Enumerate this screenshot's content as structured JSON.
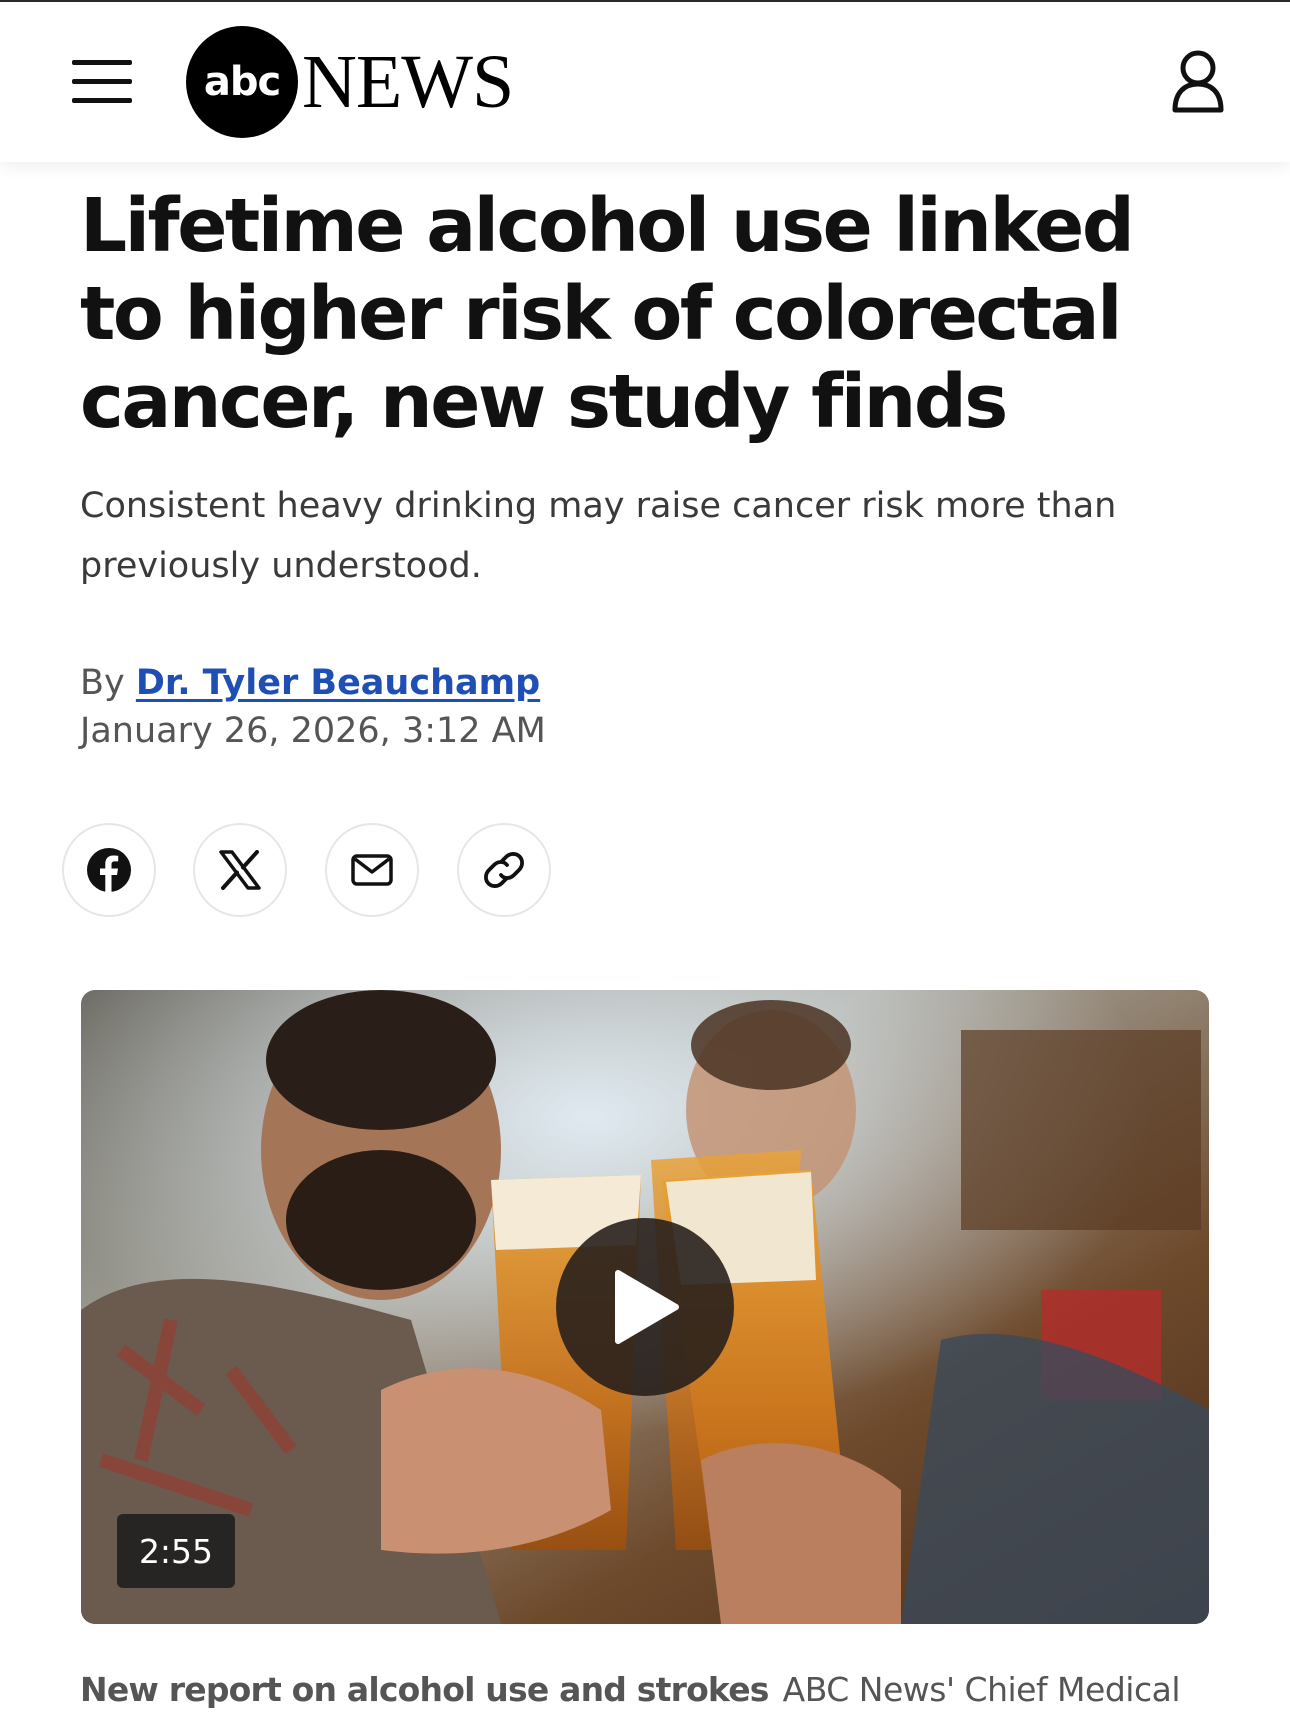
{
  "header": {
    "menu_icon": "hamburger-menu-icon",
    "logo_mark": "abc",
    "logo_word": "NEWS",
    "account_icon": "user-account-icon"
  },
  "article": {
    "headline": "Lifetime alcohol use linked to higher risk of colorectal cancer, new study finds",
    "subheadline": "Consistent heavy drinking may raise cancer risk more than previously understood.",
    "byline_prefix": "By",
    "author": "Dr. Tyler Beauchamp",
    "timestamp": "January 26, 2026, 3:12 AM"
  },
  "share": [
    {
      "icon": "facebook-icon"
    },
    {
      "icon": "x-icon"
    },
    {
      "icon": "email-icon"
    },
    {
      "icon": "link-icon"
    }
  ],
  "video": {
    "duration": "2:55",
    "play_icon": "play-icon",
    "caption_title": "New report on alcohol use and strokes",
    "caption_text": "ABC News' Chief Medical"
  },
  "colors": {
    "author_link": "#1f4fb5",
    "headline": "#111111",
    "secondary_text": "#555555"
  }
}
